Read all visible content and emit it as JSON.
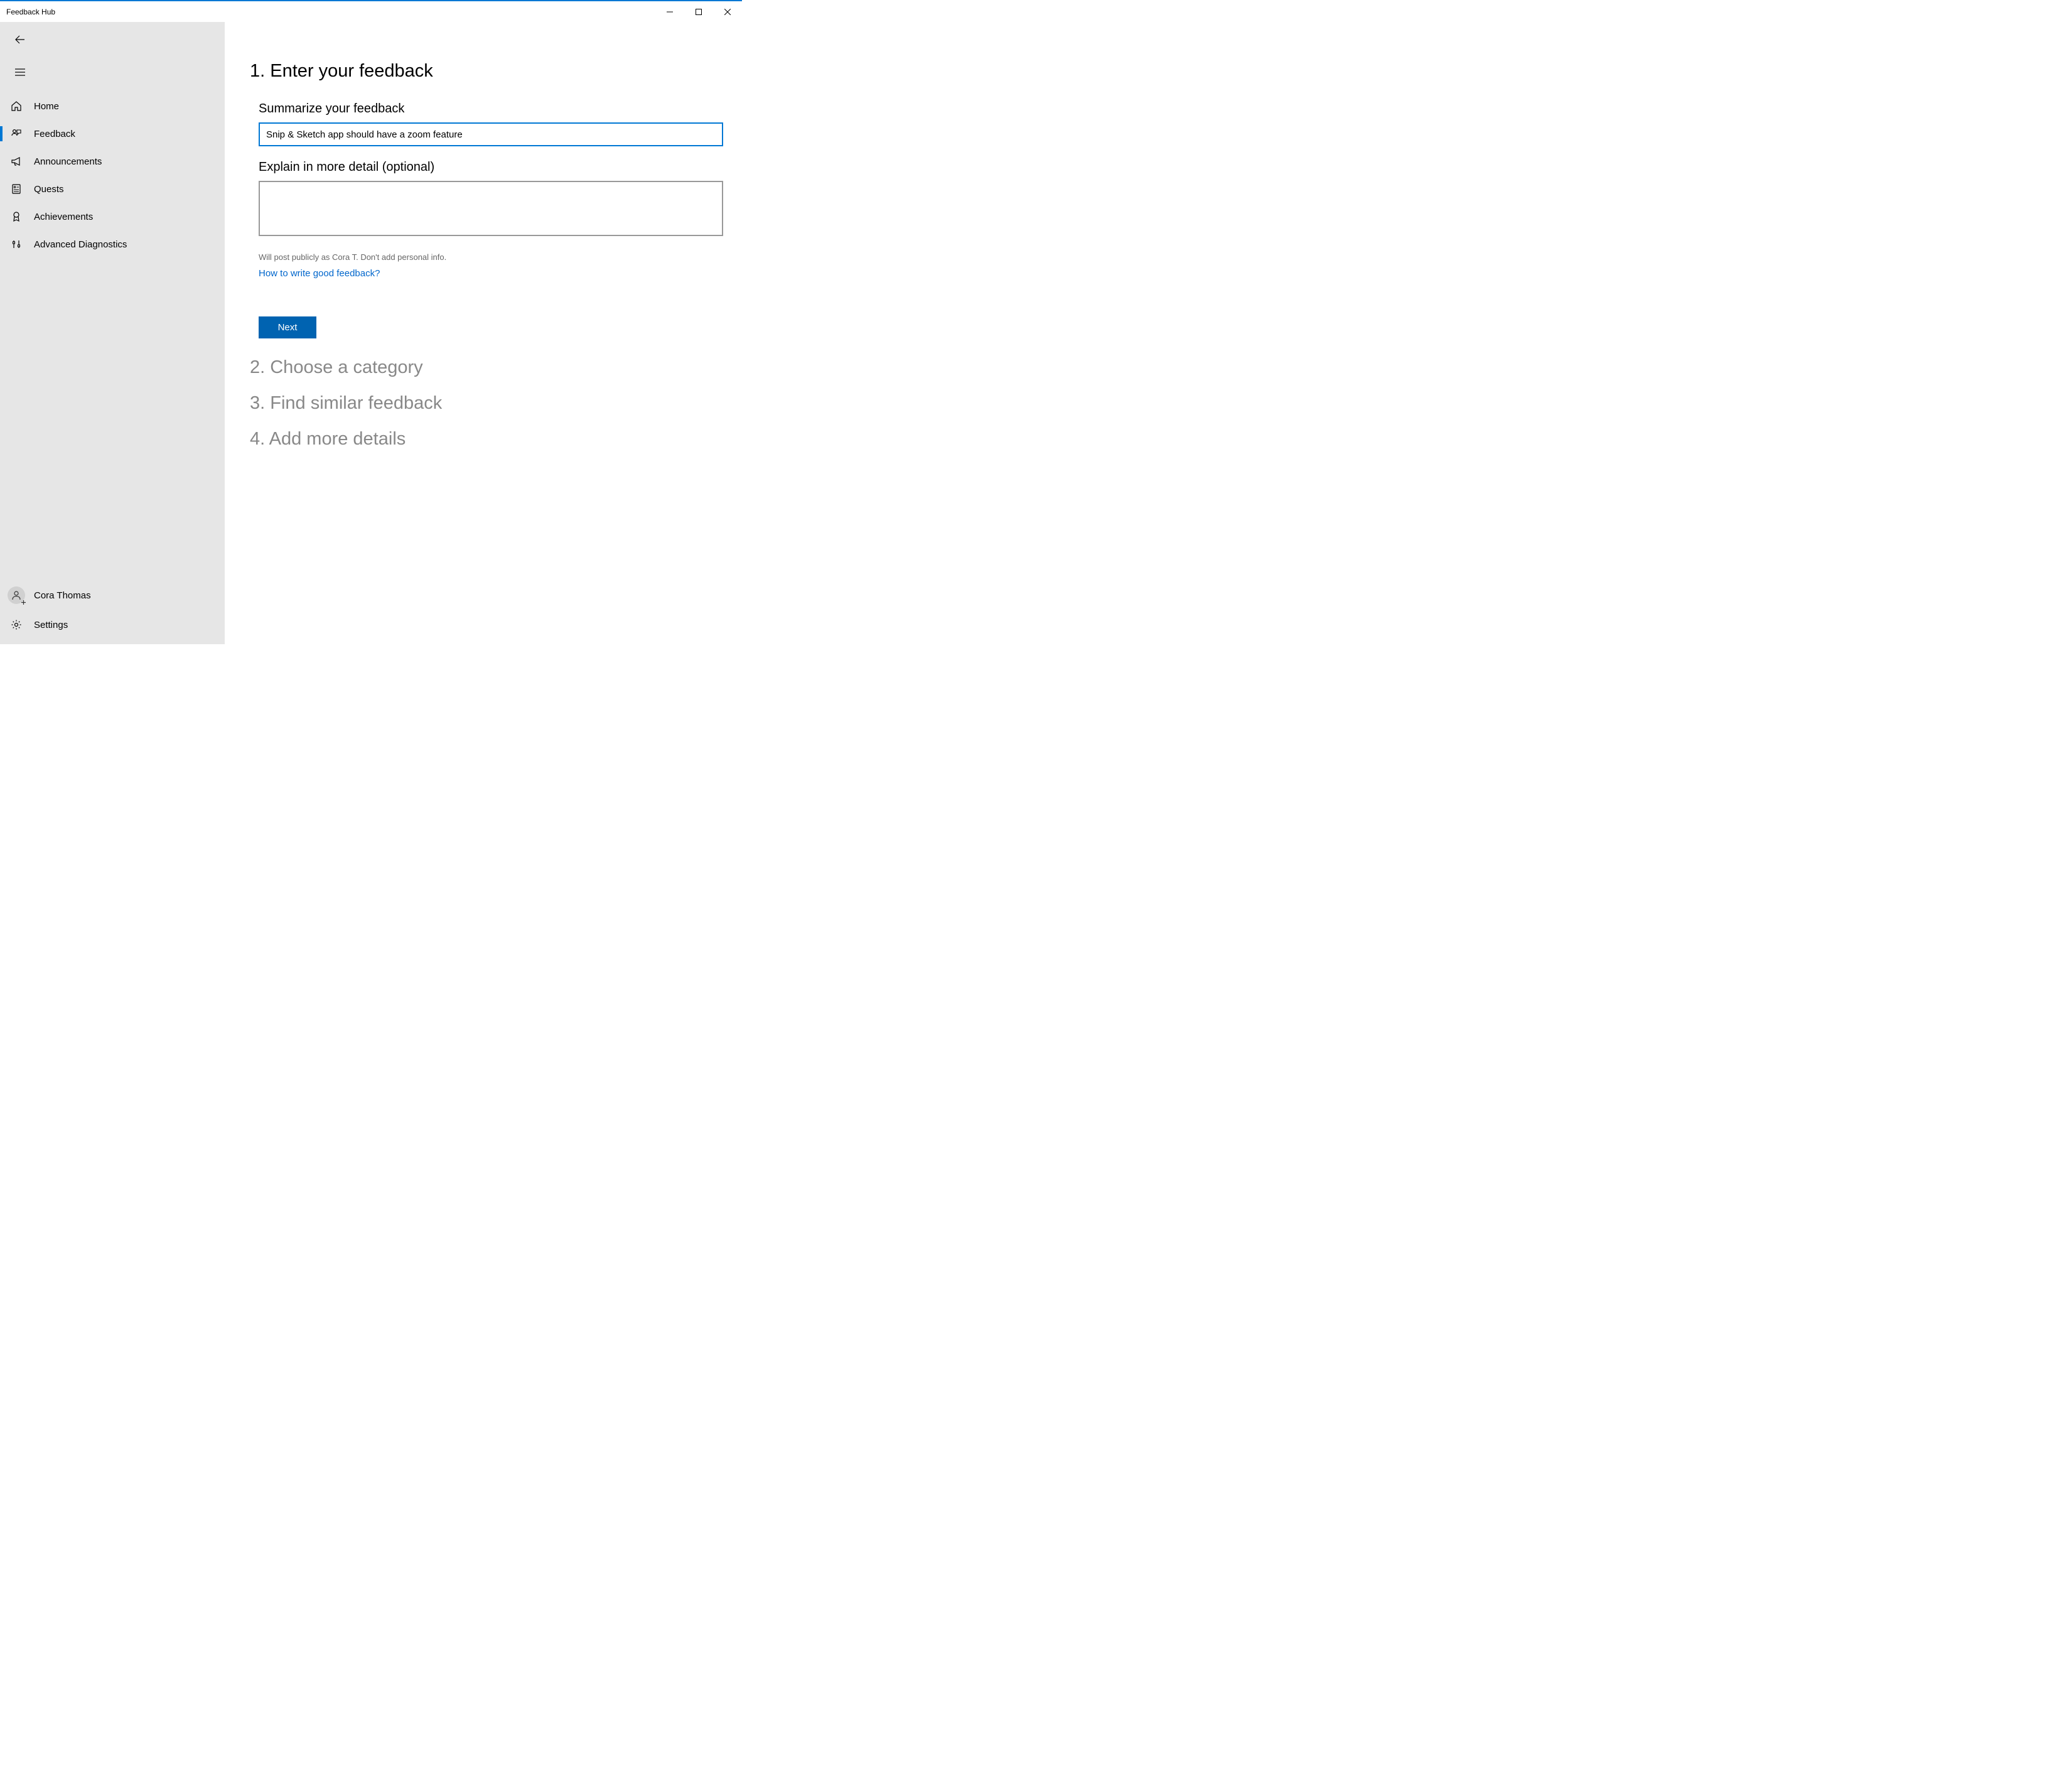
{
  "window": {
    "title": "Feedback Hub"
  },
  "sidebar": {
    "items": [
      {
        "label": "Home",
        "icon": "home"
      },
      {
        "label": "Feedback",
        "icon": "feedback",
        "selected": true
      },
      {
        "label": "Announcements",
        "icon": "announcements"
      },
      {
        "label": "Quests",
        "icon": "quests"
      },
      {
        "label": "Achievements",
        "icon": "achievements"
      },
      {
        "label": "Advanced Diagnostics",
        "icon": "diagnostics"
      }
    ],
    "user_name": "Cora Thomas",
    "settings_label": "Settings"
  },
  "main": {
    "step1": {
      "heading": "1. Enter your feedback",
      "summary_label": "Summarize your feedback",
      "summary_value": "Snip & Sketch app should have a zoom feature",
      "detail_label": "Explain in more detail (optional)",
      "detail_value": "",
      "disclaimer": "Will post publicly as Cora T. Don't add personal info.",
      "help_link": "How to write good feedback?",
      "next_button": "Next"
    },
    "step2_heading": "2. Choose a category",
    "step3_heading": "3. Find similar feedback",
    "step4_heading": "4. Add more details"
  }
}
